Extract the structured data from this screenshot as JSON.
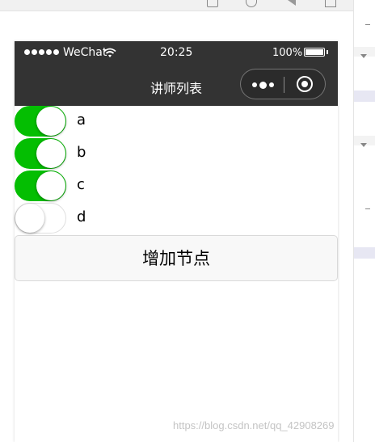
{
  "status_bar": {
    "carrier": "WeChat",
    "time": "20:25",
    "battery": "100%"
  },
  "nav": {
    "title": "讲师列表"
  },
  "switches": [
    {
      "label": "a",
      "checked": true
    },
    {
      "label": "b",
      "checked": true
    },
    {
      "label": "c",
      "checked": true
    },
    {
      "label": "d",
      "checked": false
    }
  ],
  "add_button": {
    "label": "增加节点"
  },
  "watermark": "https://blog.csdn.net/qq_42908269",
  "colors": {
    "switch_on": "#04be02",
    "nav_background": "#333333"
  }
}
